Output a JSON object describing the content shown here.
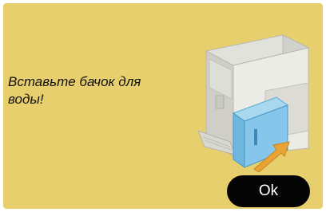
{
  "dialog": {
    "message": "Вставьте бачок для воды!",
    "ok_label": "Ok",
    "illustration_icon": "coffee-machine-water-tank-insert-icon"
  },
  "colors": {
    "background": "#e8cf6e",
    "button": "#050505",
    "button_text": "#ffffff",
    "tank": "#7fc3e6",
    "arrow": "#e8a236"
  }
}
